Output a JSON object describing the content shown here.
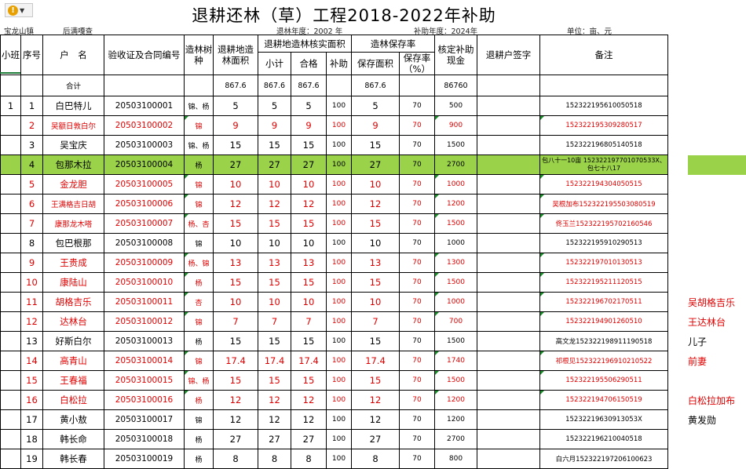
{
  "title": "退耕还林（草）工程2018-2022年补助",
  "subheader": {
    "town": "宝龙山镇",
    "village": "后满嘎查",
    "year_info": "退林年度：2002 年",
    "subsidy_year": "补助年度：2024年",
    "unit": "单位：亩、元"
  },
  "headers": {
    "xiaoban": "小班",
    "seq": "序号",
    "household": "户　名",
    "contract": "验收证及合同编号",
    "species": "造林树种",
    "area": "退耕地造林面积",
    "verified_group": "退耕地造林核实面积",
    "subtotal": "小计",
    "qualified": "合格",
    "subsidy": "补助",
    "preserve_group": "造林保存率",
    "preserve_area": "保存面积",
    "preserve_rate": "保存率（%）",
    "cash": "核定补助现金",
    "sign": "退耕户签字",
    "remark": "备注"
  },
  "total": {
    "label": "合计",
    "area": "867.6",
    "subtotal": "867.6",
    "qualified": "867.6",
    "preserve_area": "867.6",
    "cash": "86760"
  },
  "rows": [
    {
      "xb": "1",
      "seq": "1",
      "name": "白巴特儿",
      "contract": "20503100001",
      "species": "锦、杨",
      "area": "5",
      "sub": "5",
      "qual": "5",
      "subsidy": "100",
      "parea": "5",
      "rate": "70",
      "cash": "500",
      "remark": "152322195610050518",
      "extra": ""
    },
    {
      "xb": "",
      "seq": "2",
      "name": "吴额日敦白尔",
      "contract": "20503100002",
      "species": "锦",
      "area": "9",
      "sub": "9",
      "qual": "9",
      "subsidy": "100",
      "parea": "9",
      "rate": "70",
      "cash": "900",
      "remark": "152322195309280517",
      "extra": ""
    },
    {
      "xb": "",
      "seq": "3",
      "name": "吴宝庆",
      "contract": "20503100003",
      "species": "锦、杨",
      "area": "15",
      "sub": "15",
      "qual": "15",
      "subsidy": "100",
      "parea": "15",
      "rate": "70",
      "cash": "1500",
      "remark": "152322196805140518",
      "extra": ""
    },
    {
      "xb": "",
      "seq": "4",
      "name": "包那木拉",
      "contract": "20503100004",
      "species": "杨",
      "area": "27",
      "sub": "27",
      "qual": "27",
      "subsidy": "100",
      "parea": "27",
      "rate": "70",
      "cash": "2700",
      "remark": "包八十一10亩 152322197701070533X、包七十八17",
      "extra": ""
    },
    {
      "xb": "",
      "seq": "5",
      "name": "金龙胆",
      "contract": "20503100005",
      "species": "锦",
      "area": "10",
      "sub": "10",
      "qual": "10",
      "subsidy": "100",
      "parea": "10",
      "rate": "70",
      "cash": "1000",
      "remark": "152322194304050515",
      "extra": ""
    },
    {
      "xb": "",
      "seq": "6",
      "name": "王满格吉日胡",
      "contract": "20503100006",
      "species": "锦",
      "area": "12",
      "sub": "12",
      "qual": "12",
      "subsidy": "100",
      "parea": "12",
      "rate": "70",
      "cash": "1200",
      "remark": "吴根加布152322195503080519",
      "extra": ""
    },
    {
      "xb": "",
      "seq": "7",
      "name": "康那龙木嗒",
      "contract": "20503100007",
      "species": "杨、杏",
      "area": "15",
      "sub": "15",
      "qual": "15",
      "subsidy": "100",
      "parea": "15",
      "rate": "70",
      "cash": "1500",
      "remark": "佟玉兰152322195702160546",
      "extra": ""
    },
    {
      "xb": "",
      "seq": "8",
      "name": "包巴根那",
      "contract": "20503100008",
      "species": "锦",
      "area": "10",
      "sub": "10",
      "qual": "10",
      "subsidy": "100",
      "parea": "10",
      "rate": "70",
      "cash": "1000",
      "remark": "152322195910290513",
      "extra": ""
    },
    {
      "xb": "",
      "seq": "9",
      "name": "王贵成",
      "contract": "20503100009",
      "species": "杨、锦",
      "area": "13",
      "sub": "13",
      "qual": "13",
      "subsidy": "100",
      "parea": "13",
      "rate": "70",
      "cash": "1300",
      "remark": "152322197010130513",
      "extra": ""
    },
    {
      "xb": "",
      "seq": "10",
      "name": "康陆山",
      "contract": "20503100010",
      "species": "杨",
      "area": "15",
      "sub": "15",
      "qual": "15",
      "subsidy": "100",
      "parea": "15",
      "rate": "70",
      "cash": "1500",
      "remark": "152322195211120515",
      "extra": ""
    },
    {
      "xb": "",
      "seq": "11",
      "name": "胡格吉乐",
      "contract": "20503100011",
      "species": "杏",
      "area": "10",
      "sub": "10",
      "qual": "10",
      "subsidy": "100",
      "parea": "10",
      "rate": "70",
      "cash": "1000",
      "remark": "152322196702170511",
      "extra": "吴胡格吉乐"
    },
    {
      "xb": "",
      "seq": "12",
      "name": "达林台",
      "contract": "20503100012",
      "species": "锦",
      "area": "7",
      "sub": "7",
      "qual": "7",
      "subsidy": "100",
      "parea": "7",
      "rate": "70",
      "cash": "700",
      "remark": "152322194901260510",
      "extra": "王达林台"
    },
    {
      "xb": "",
      "seq": "13",
      "name": "好斯白尔",
      "contract": "20503100013",
      "species": "杨",
      "area": "15",
      "sub": "15",
      "qual": "15",
      "subsidy": "100",
      "parea": "15",
      "rate": "70",
      "cash": "1500",
      "remark": "高文龙152322198911190518",
      "extra": "儿子"
    },
    {
      "xb": "",
      "seq": "14",
      "name": "高青山",
      "contract": "20503100014",
      "species": "锦",
      "area": "17.4",
      "sub": "17.4",
      "qual": "17.4",
      "subsidy": "100",
      "parea": "17.4",
      "rate": "70",
      "cash": "1740",
      "remark": "祁根见152322196910210522",
      "extra": "前妻"
    },
    {
      "xb": "",
      "seq": "15",
      "name": "王春福",
      "contract": "20503100015",
      "species": "锦、杨",
      "area": "15",
      "sub": "15",
      "qual": "15",
      "subsidy": "100",
      "parea": "15",
      "rate": "70",
      "cash": "1500",
      "remark": "152322195506290511",
      "extra": ""
    },
    {
      "xb": "",
      "seq": "16",
      "name": "白松拉",
      "contract": "20503100016",
      "species": "杨",
      "area": "12",
      "sub": "12",
      "qual": "12",
      "subsidy": "100",
      "parea": "12",
      "rate": "70",
      "cash": "1200",
      "remark": "152322194706150519",
      "extra": "白松拉加布"
    },
    {
      "xb": "",
      "seq": "17",
      "name": "黄小敖",
      "contract": "20503100017",
      "species": "锦",
      "area": "12",
      "sub": "12",
      "qual": "12",
      "subsidy": "100",
      "parea": "12",
      "rate": "70",
      "cash": "1200",
      "remark": "15232219630913053X",
      "extra": "黄发勋"
    },
    {
      "xb": "",
      "seq": "18",
      "name": "韩长命",
      "contract": "20503100018",
      "species": "杨",
      "area": "27",
      "sub": "27",
      "qual": "27",
      "subsidy": "100",
      "parea": "27",
      "rate": "70",
      "cash": "2700",
      "remark": "152322196210040518",
      "extra": ""
    },
    {
      "xb": "",
      "seq": "19",
      "name": "韩长春",
      "contract": "20503100019",
      "species": "杨",
      "area": "8",
      "sub": "8",
      "qual": "8",
      "subsidy": "100",
      "parea": "8",
      "rate": "70",
      "cash": "800",
      "remark": "白六月152322197206100623",
      "extra": ""
    }
  ],
  "row_styles": {
    "red_rows": [
      2,
      5,
      6,
      7,
      9,
      10,
      11,
      12,
      14,
      15,
      16
    ],
    "highlight_row": 4,
    "highlight_color": "#9ad24a",
    "red_color": "#e00000"
  },
  "warning_icon": "warning-icon"
}
